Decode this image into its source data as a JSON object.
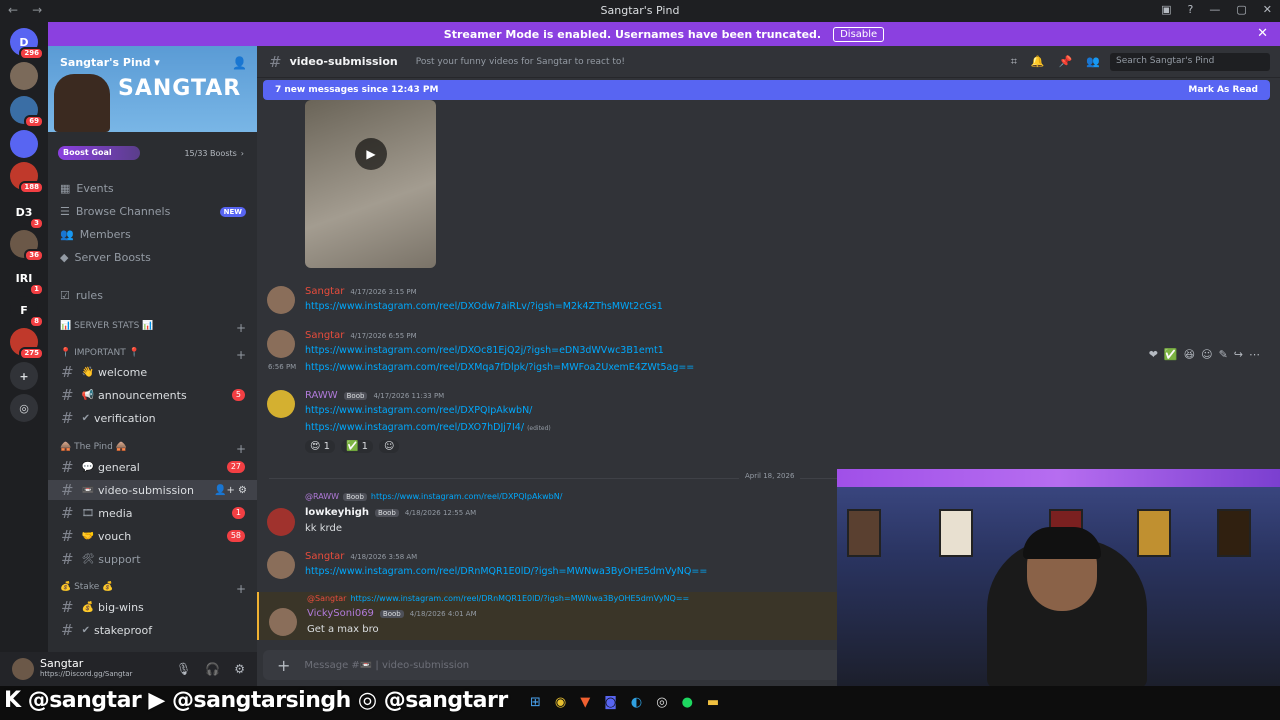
{
  "window": {
    "title": "Sangtar's Pind"
  },
  "rail": {
    "servers": [
      {
        "label": "D",
        "badge": "296",
        "color": "#5865f2"
      },
      {
        "label": "",
        "badge": "",
        "color": "#7b6a5a"
      },
      {
        "label": "",
        "badge": "69",
        "color": "#3a6ea5"
      },
      {
        "label": "",
        "badge": "",
        "color": "#5865f2"
      },
      {
        "label": "",
        "badge": "188",
        "color": "#c0392b"
      },
      {
        "label": "D3",
        "badge": "3",
        "color": "#1e1f22"
      },
      {
        "label": "",
        "badge": "36",
        "color": "#6b5848"
      },
      {
        "label": "IRI",
        "badge": "1",
        "color": "#1e1f22"
      },
      {
        "label": "F",
        "badge": "8",
        "color": "#1e1f22"
      },
      {
        "label": "",
        "badge": "275",
        "color": "#c0392b"
      }
    ]
  },
  "banner": {
    "text": "Streamer Mode is enabled. Usernames have been truncated.",
    "button": "Disable",
    "close": "✕"
  },
  "sidebar": {
    "server_name": "Sangtar's Pind",
    "header_logo": "SANGTAR",
    "boost_label": "Boost Goal",
    "boost_count": "15/33 Boosts",
    "boost_fraction": 0.45,
    "items": [
      {
        "label": "Events",
        "icon": "calendar-icon"
      },
      {
        "label": "Browse Channels",
        "icon": "browse-icon",
        "badge": "NEW"
      },
      {
        "label": "Members",
        "icon": "members-icon"
      },
      {
        "label": "Server Boosts",
        "icon": "boost-icon"
      },
      {
        "label": "rules",
        "icon": "rules-icon"
      }
    ],
    "categories": {
      "stats": "📊 SERVER STATS 📊",
      "important": "📍 IMPORTANT 📍",
      "pind": "🛖 The Pind 🛖",
      "stake": "💰 Stake 💰"
    },
    "channels": [
      {
        "emoji": "👋",
        "name": "welcome",
        "badge": ""
      },
      {
        "emoji": "📢",
        "name": "announcements",
        "badge": "5"
      },
      {
        "emoji": "✔",
        "name": "verification",
        "badge": ""
      },
      {
        "emoji": "💬",
        "name": "general",
        "badge": "27"
      },
      {
        "emoji": "📼",
        "name": "video-submission",
        "badge": ""
      },
      {
        "emoji": "🎞",
        "name": "media",
        "badge": "1"
      },
      {
        "emoji": "🤝",
        "name": "vouch",
        "badge": "58"
      },
      {
        "emoji": "🛠",
        "name": "support",
        "badge": ""
      },
      {
        "emoji": "💰",
        "name": "big-wins",
        "badge": ""
      },
      {
        "emoji": "✔",
        "name": "stakeproof",
        "badge": ""
      }
    ]
  },
  "user": {
    "name": "Sangtar",
    "status": "https://Discord.gg/Sangtar"
  },
  "channel": {
    "name": "video-submission",
    "topic": "Post your funny videos for Sangtar to react to!",
    "search_placeholder": "Search Sangtar's Pind",
    "new_messages": "7 new messages since 12:43 PM",
    "mark_read": "Mark As Read",
    "composer_placeholder": "Message #📼 | video-submission"
  },
  "messages": [
    {
      "author": "Sangtar",
      "time": "4/17/2026 3:15 PM",
      "links": [
        "https://www.instagram.com/reel/DXOdw7aiRLv/?igsh=M2k4ZThsMWt2cGs1"
      ]
    },
    {
      "author": "Sangtar",
      "time": "4/17/2026 6:55 PM",
      "links": [
        "https://www.instagram.com/reel/DXOc81EjQ2j/?igsh=eDN3dWVwc3B1emt1",
        "https://www.instagram.com/reel/DXMqa7fDlpk/?igsh=MWFoa2UxemE4ZWt5ag=="
      ],
      "side_time": "6:56 PM"
    },
    {
      "author": "RAWW",
      "tag": "Boob",
      "time": "4/17/2026 11:33 PM",
      "links": [
        "https://www.instagram.com/reel/DXPQIpAkwbN/",
        "https://www.instagram.com/reel/DXO7hDJj7I4/"
      ],
      "edited": "(edited)",
      "reactions": [
        "😍 1",
        "✅ 1",
        "☺"
      ]
    },
    {
      "date_divider": "April 18, 2026"
    },
    {
      "reply_to": "@RAWW",
      "reply_tag": "Boob",
      "reply_text": "https://www.instagram.com/reel/DXPQIpAkwbN/",
      "author": "lowkeyhigh",
      "tag": "Boob",
      "time": "4/18/2026 12:55 AM",
      "text": "kk krde"
    },
    {
      "author": "Sangtar",
      "time": "4/18/2026 3:58 AM",
      "links": [
        "https://www.instagram.com/reel/DRnMQR1E0lD/?igsh=MWNwa3ByOHE5dmVyNQ=="
      ]
    },
    {
      "reply_to": "@Sangtar",
      "reply_text": "https://www.instagram.com/reel/DRnMQR1E0lD/?igsh=MWNwa3ByOHE5dmVyNQ==",
      "author": "VickySoni069",
      "tag": "Boob",
      "time": "4/18/2026 4:01 AM",
      "text": "Get a max bro"
    }
  ],
  "taskbar": {
    "handles": "K @sangtar ▶ @sangtarsingh ◎ @sangtarr"
  }
}
